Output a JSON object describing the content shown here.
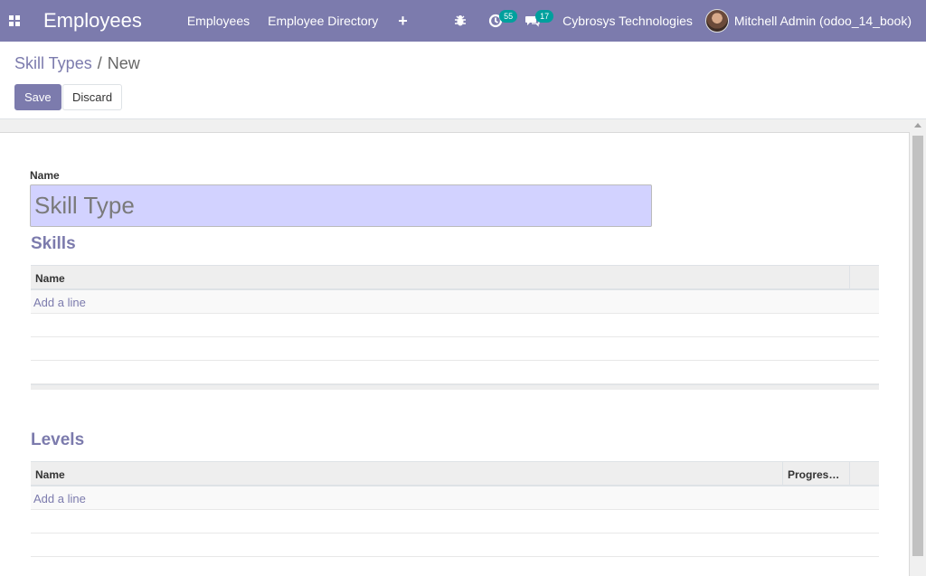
{
  "navbar": {
    "app_title": "Employees",
    "menu": [
      "Employees",
      "Employee Directory"
    ],
    "activity_count": "55",
    "message_count": "17",
    "company": "Cybrosys Technologies",
    "user": "Mitchell Admin (odoo_14_book)",
    "color": "#7c7bad"
  },
  "breadcrumb": {
    "parent": "Skill Types",
    "separator": "/",
    "current": "New"
  },
  "buttons": {
    "save": "Save",
    "discard": "Discard"
  },
  "form": {
    "name_label": "Name",
    "name_placeholder": "Skill Type",
    "skills": {
      "title": "Skills",
      "columns": [
        "Name"
      ],
      "add_line": "Add a line"
    },
    "levels": {
      "title": "Levels",
      "columns": [
        "Name",
        "Progres…"
      ],
      "add_line": "Add a line"
    }
  },
  "icons": [
    "apps-grid-icon",
    "bug-icon",
    "activity-clock-icon",
    "chat-icon",
    "plus-icon",
    "trash-icon"
  ]
}
